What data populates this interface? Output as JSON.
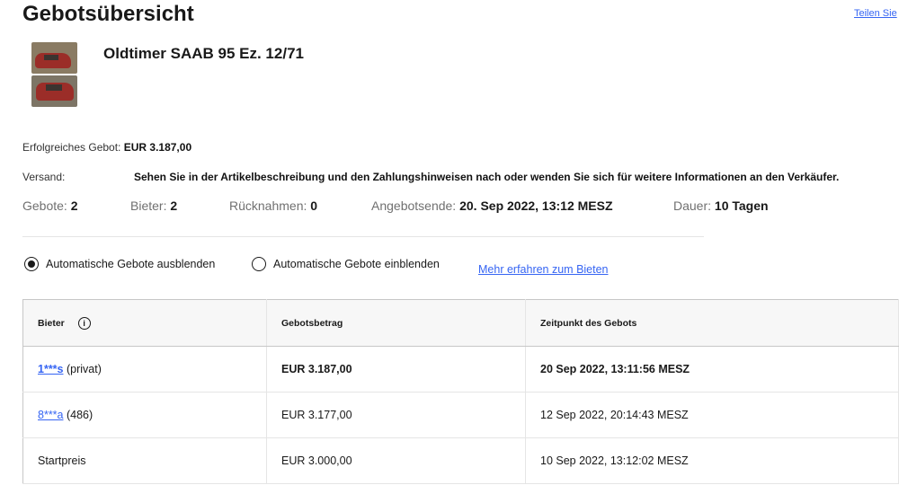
{
  "header": {
    "title": "Gebotsübersicht",
    "share_label": "Teilen Sie"
  },
  "item": {
    "title": "Oldtimer SAAB 95 Ez. 12/71"
  },
  "summary": {
    "winning_bid_label": "Erfolgreiches Gebot:",
    "winning_bid_value": "EUR 3.187,00",
    "shipping_label": "Versand:",
    "shipping_text": "Sehen Sie in der Artikelbeschreibung und den Zahlungshinweisen nach oder wenden Sie sich für weitere Informationen an den Verkäufer."
  },
  "stats": [
    {
      "label": "Gebote:",
      "value": "2"
    },
    {
      "label": "Bieter:",
      "value": "2"
    },
    {
      "label": "Rücknahmen:",
      "value": "0"
    },
    {
      "label": "Angebotsende:",
      "value": "20. Sep 2022, 13:12 MESZ"
    },
    {
      "label": "Dauer:",
      "value": "10 Tagen"
    }
  ],
  "options": {
    "hide_auto_label": "Automatische Gebote ausblenden",
    "show_auto_label": "Automatische Gebote einblenden",
    "learn_more_label": "Mehr erfahren zum Bieten",
    "selected": "hide"
  },
  "table": {
    "headers": [
      "Bieter",
      "Gebotsbetrag",
      "Zeitpunkt des Gebots"
    ],
    "rows": [
      {
        "bidder": "1***s",
        "bidder_suffix": " (privat)",
        "amount": "EUR 3.187,00",
        "time": "20 Sep 2022, 13:11:56 MESZ"
      },
      {
        "bidder": "8***a",
        "bidder_suffix": " (486)",
        "amount": "EUR 3.177,00",
        "time": "12 Sep 2022, 20:14:43 MESZ"
      },
      {
        "bidder": "Startpreis",
        "bidder_suffix": "",
        "amount": "EUR 3.000,00",
        "time": "10 Sep 2022, 13:12:02 MESZ"
      }
    ]
  },
  "colors": {
    "link": "#3665f3",
    "text": "#191919",
    "muted": "#707070"
  }
}
